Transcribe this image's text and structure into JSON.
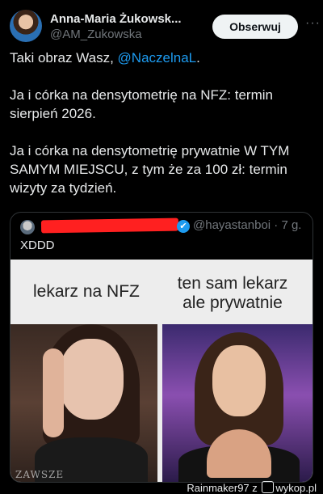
{
  "author": {
    "name": "Anna-Maria Żukowsk...",
    "handle": "@AM_Zukowska",
    "follow_label": "Obserwuj",
    "more_label": "···"
  },
  "tweet": {
    "line1_prefix": "Taki obraz Wasz, ",
    "line1_mention": "@NaczelnaL",
    "line1_suffix": ".",
    "para2": "Ja i córka na densytometrię na NFZ: termin sierpień 2026.",
    "para3": "Ja i córka na densytometrię prywatnie W TYM SAMYM MIEJSCU, z tym że za 100 zł: termin wizyty za tydzień."
  },
  "quote": {
    "meta": "@hayastanboi · 7 g.",
    "text": "XDDD",
    "verified_icon": "✔",
    "meme": {
      "caption_left": "lekarz na NFZ",
      "caption_right": "ten sam lekarz ale prywatnie",
      "watermark": "ZAWSZE"
    }
  },
  "footer": {
    "user": "Rainmaker97",
    "connector": "z",
    "site": "wykop.pl"
  },
  "colors": {
    "accent": "#1d9bf0",
    "background": "#000000",
    "redaction": "#ff2020"
  }
}
